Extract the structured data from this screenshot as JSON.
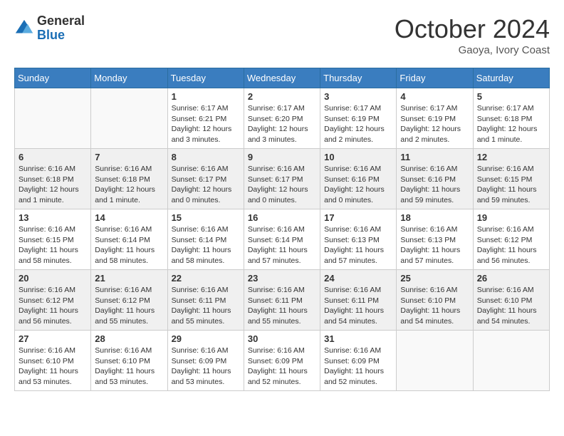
{
  "header": {
    "logo_line1": "General",
    "logo_line2": "Blue",
    "month": "October 2024",
    "location": "Gaoya, Ivory Coast"
  },
  "days_of_week": [
    "Sunday",
    "Monday",
    "Tuesday",
    "Wednesday",
    "Thursday",
    "Friday",
    "Saturday"
  ],
  "weeks": [
    [
      {
        "day": "",
        "info": ""
      },
      {
        "day": "",
        "info": ""
      },
      {
        "day": "1",
        "info": "Sunrise: 6:17 AM\nSunset: 6:21 PM\nDaylight: 12 hours and 3 minutes."
      },
      {
        "day": "2",
        "info": "Sunrise: 6:17 AM\nSunset: 6:20 PM\nDaylight: 12 hours and 3 minutes."
      },
      {
        "day": "3",
        "info": "Sunrise: 6:17 AM\nSunset: 6:19 PM\nDaylight: 12 hours and 2 minutes."
      },
      {
        "day": "4",
        "info": "Sunrise: 6:17 AM\nSunset: 6:19 PM\nDaylight: 12 hours and 2 minutes."
      },
      {
        "day": "5",
        "info": "Sunrise: 6:17 AM\nSunset: 6:18 PM\nDaylight: 12 hours and 1 minute."
      }
    ],
    [
      {
        "day": "6",
        "info": "Sunrise: 6:16 AM\nSunset: 6:18 PM\nDaylight: 12 hours and 1 minute."
      },
      {
        "day": "7",
        "info": "Sunrise: 6:16 AM\nSunset: 6:18 PM\nDaylight: 12 hours and 1 minute."
      },
      {
        "day": "8",
        "info": "Sunrise: 6:16 AM\nSunset: 6:17 PM\nDaylight: 12 hours and 0 minutes."
      },
      {
        "day": "9",
        "info": "Sunrise: 6:16 AM\nSunset: 6:17 PM\nDaylight: 12 hours and 0 minutes."
      },
      {
        "day": "10",
        "info": "Sunrise: 6:16 AM\nSunset: 6:16 PM\nDaylight: 12 hours and 0 minutes."
      },
      {
        "day": "11",
        "info": "Sunrise: 6:16 AM\nSunset: 6:16 PM\nDaylight: 11 hours and 59 minutes."
      },
      {
        "day": "12",
        "info": "Sunrise: 6:16 AM\nSunset: 6:15 PM\nDaylight: 11 hours and 59 minutes."
      }
    ],
    [
      {
        "day": "13",
        "info": "Sunrise: 6:16 AM\nSunset: 6:15 PM\nDaylight: 11 hours and 58 minutes."
      },
      {
        "day": "14",
        "info": "Sunrise: 6:16 AM\nSunset: 6:14 PM\nDaylight: 11 hours and 58 minutes."
      },
      {
        "day": "15",
        "info": "Sunrise: 6:16 AM\nSunset: 6:14 PM\nDaylight: 11 hours and 58 minutes."
      },
      {
        "day": "16",
        "info": "Sunrise: 6:16 AM\nSunset: 6:14 PM\nDaylight: 11 hours and 57 minutes."
      },
      {
        "day": "17",
        "info": "Sunrise: 6:16 AM\nSunset: 6:13 PM\nDaylight: 11 hours and 57 minutes."
      },
      {
        "day": "18",
        "info": "Sunrise: 6:16 AM\nSunset: 6:13 PM\nDaylight: 11 hours and 57 minutes."
      },
      {
        "day": "19",
        "info": "Sunrise: 6:16 AM\nSunset: 6:12 PM\nDaylight: 11 hours and 56 minutes."
      }
    ],
    [
      {
        "day": "20",
        "info": "Sunrise: 6:16 AM\nSunset: 6:12 PM\nDaylight: 11 hours and 56 minutes."
      },
      {
        "day": "21",
        "info": "Sunrise: 6:16 AM\nSunset: 6:12 PM\nDaylight: 11 hours and 55 minutes."
      },
      {
        "day": "22",
        "info": "Sunrise: 6:16 AM\nSunset: 6:11 PM\nDaylight: 11 hours and 55 minutes."
      },
      {
        "day": "23",
        "info": "Sunrise: 6:16 AM\nSunset: 6:11 PM\nDaylight: 11 hours and 55 minutes."
      },
      {
        "day": "24",
        "info": "Sunrise: 6:16 AM\nSunset: 6:11 PM\nDaylight: 11 hours and 54 minutes."
      },
      {
        "day": "25",
        "info": "Sunrise: 6:16 AM\nSunset: 6:10 PM\nDaylight: 11 hours and 54 minutes."
      },
      {
        "day": "26",
        "info": "Sunrise: 6:16 AM\nSunset: 6:10 PM\nDaylight: 11 hours and 54 minutes."
      }
    ],
    [
      {
        "day": "27",
        "info": "Sunrise: 6:16 AM\nSunset: 6:10 PM\nDaylight: 11 hours and 53 minutes."
      },
      {
        "day": "28",
        "info": "Sunrise: 6:16 AM\nSunset: 6:10 PM\nDaylight: 11 hours and 53 minutes."
      },
      {
        "day": "29",
        "info": "Sunrise: 6:16 AM\nSunset: 6:09 PM\nDaylight: 11 hours and 53 minutes."
      },
      {
        "day": "30",
        "info": "Sunrise: 6:16 AM\nSunset: 6:09 PM\nDaylight: 11 hours and 52 minutes."
      },
      {
        "day": "31",
        "info": "Sunrise: 6:16 AM\nSunset: 6:09 PM\nDaylight: 11 hours and 52 minutes."
      },
      {
        "day": "",
        "info": ""
      },
      {
        "day": "",
        "info": ""
      }
    ]
  ]
}
